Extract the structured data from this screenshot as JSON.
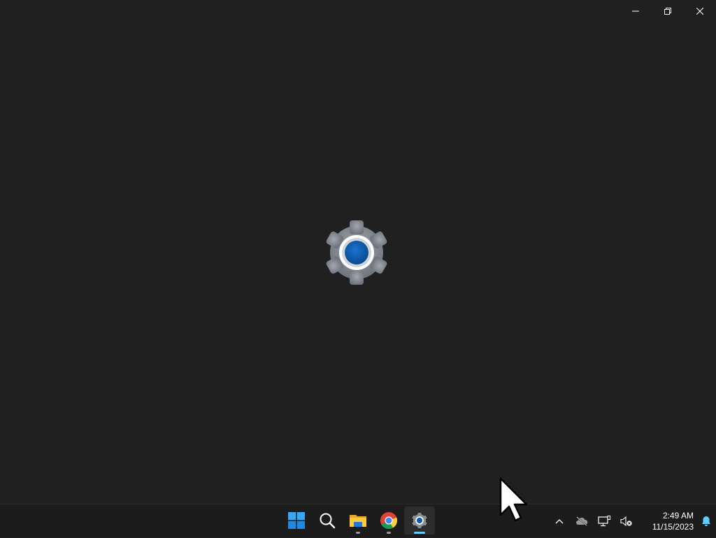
{
  "window": {
    "splash_icon": "settings-gear-icon",
    "caption_buttons": {
      "minimize": "minimize-icon",
      "restore": "restore-icon",
      "close": "close-icon"
    }
  },
  "taskbar": {
    "apps": [
      {
        "name": "start",
        "icon": "windows-logo-icon"
      },
      {
        "name": "search",
        "icon": "search-icon"
      },
      {
        "name": "file-explorer",
        "icon": "folder-icon"
      },
      {
        "name": "chrome",
        "icon": "chrome-icon"
      },
      {
        "name": "settings",
        "icon": "settings-gear-icon"
      }
    ],
    "tray": {
      "overflow_icon": "chevron-up-icon",
      "onedrive_icon": "cloud-offline-icon",
      "network_icon": "network-icon",
      "volume_icon": "volume-muted-icon",
      "time": "2:49 AM",
      "date": "11/15/2023",
      "notification_icon": "bell-icon"
    }
  },
  "colors": {
    "background": "#202020",
    "taskbar": "#1c1c1c",
    "accent": "#60cdff",
    "gear_gray": "#8a8f97",
    "gear_blue": "#0f5aa8"
  }
}
